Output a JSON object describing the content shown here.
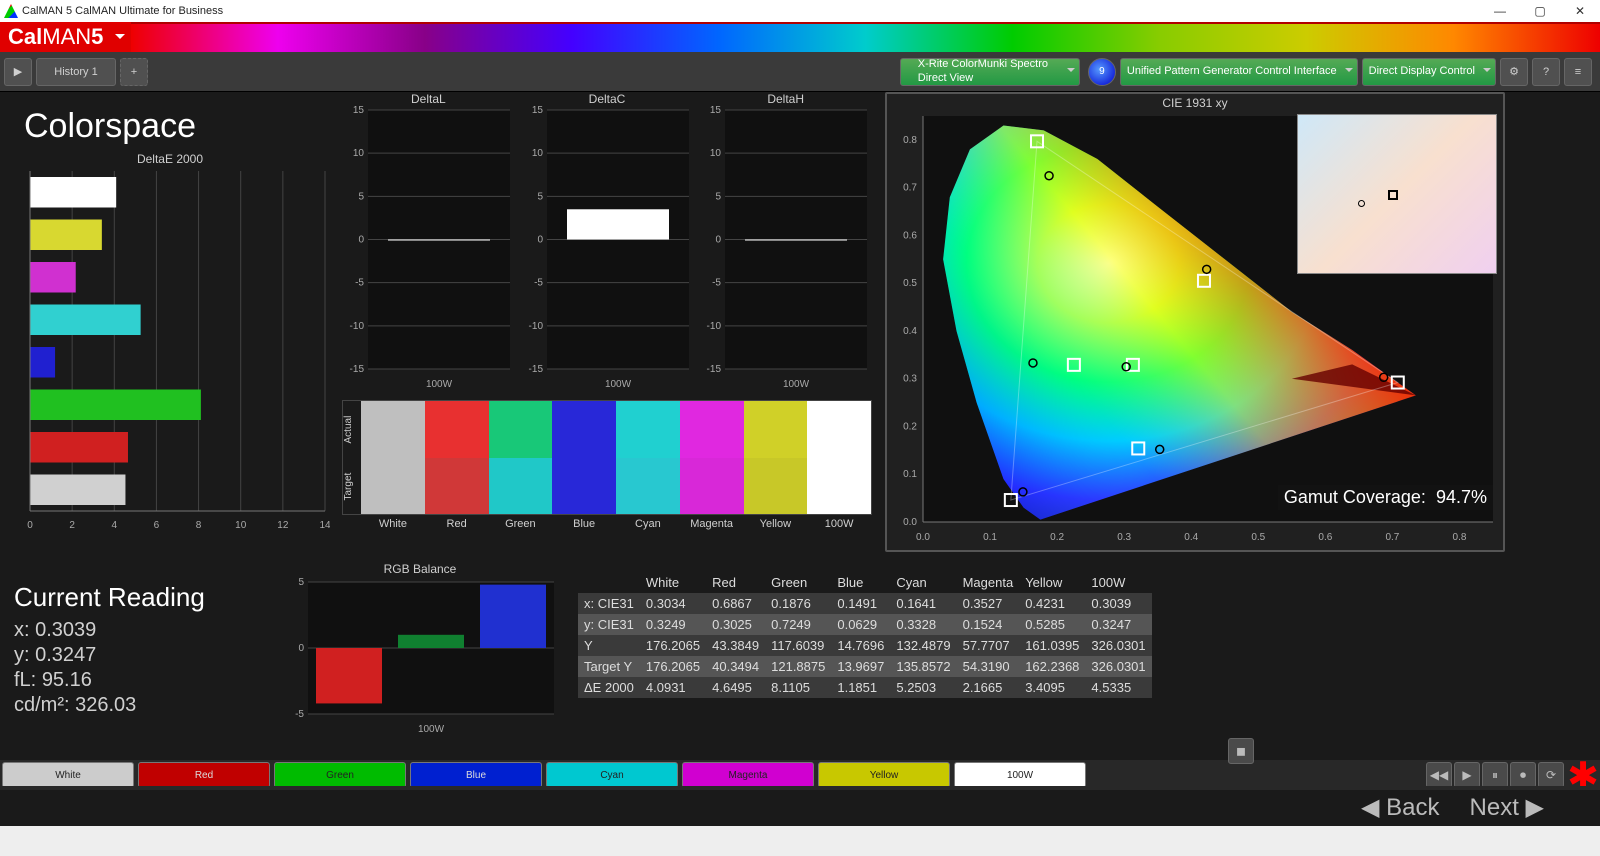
{
  "window": {
    "title": "CalMAN 5 CalMAN Ultimate for Business",
    "minimize": "—",
    "maximize": "▢",
    "close": "✕"
  },
  "brand": {
    "name_a": "Cal",
    "name_b": "MAN",
    "name_c": "5"
  },
  "toolbar": {
    "history_tab": "History 1",
    "meter": "X-Rite ColorMunki Spectro\nDirect View",
    "meter_badge": "9",
    "source": "Unified Pattern Generator Control Interface",
    "display": "Direct Display Control"
  },
  "page": {
    "title": "Colorspace",
    "current_heading": "Current Reading",
    "current": {
      "x_label": "x:",
      "x": "0.3039",
      "y_label": "y:",
      "y": "0.3247",
      "fl_label": "fL:",
      "fl": "95.16",
      "cd_label": "cd/m²:",
      "cd": "326.03"
    }
  },
  "footer": {
    "back": "Back",
    "next": "Next",
    "colors": [
      "White",
      "Red",
      "Green",
      "Blue",
      "Cyan",
      "Magenta",
      "Yellow",
      "100W"
    ],
    "fills": [
      "#cccccc",
      "#c00000",
      "#00bb00",
      "#0020d0",
      "#00c8d0",
      "#d000d0",
      "#c8c800",
      "#ffffff"
    ]
  },
  "cie": {
    "title": "CIE 1931 xy",
    "gamut_label": "Gamut Coverage:",
    "gamut_value": "94.7%"
  },
  "table": {
    "cols": [
      "",
      "White",
      "Red",
      "Green",
      "Blue",
      "Cyan",
      "Magenta",
      "Yellow",
      "100W"
    ],
    "rows": [
      [
        "x: CIE31",
        "0.3034",
        "0.6867",
        "0.1876",
        "0.1491",
        "0.1641",
        "0.3527",
        "0.4231",
        "0.3039"
      ],
      [
        "y: CIE31",
        "0.3249",
        "0.3025",
        "0.7249",
        "0.0629",
        "0.3328",
        "0.1524",
        "0.5285",
        "0.3247"
      ],
      [
        "Y",
        "176.2065",
        "43.3849",
        "117.6039",
        "14.7696",
        "132.4879",
        "57.7707",
        "161.0395",
        "326.0301"
      ],
      [
        "Target Y",
        "176.2065",
        "40.3494",
        "121.8875",
        "13.9697",
        "135.8572",
        "54.3190",
        "162.2368",
        "326.0301"
      ],
      [
        "ΔE 2000",
        "4.0931",
        "4.6495",
        "8.1105",
        "1.1851",
        "5.2503",
        "2.1665",
        "3.4095",
        "4.5335"
      ]
    ]
  },
  "chart_data": {
    "deltaE": {
      "type": "bar",
      "title": "DeltaE 2000",
      "xlim": [
        0,
        14
      ],
      "categories": [
        "White",
        "Yellow",
        "Magenta",
        "Cyan",
        "Blue",
        "Green",
        "Red",
        "100W"
      ],
      "values": [
        4.09,
        3.41,
        2.17,
        5.25,
        1.19,
        8.11,
        4.65,
        4.53
      ],
      "colors": [
        "#ffffff",
        "#d8d830",
        "#d030d0",
        "#30d0d0",
        "#2020d0",
        "#20c020",
        "#d02020",
        "#d0d0d0"
      ]
    },
    "deltaL": {
      "type": "bar",
      "title": "DeltaL",
      "ylim": [
        -15,
        15
      ],
      "point": "100W",
      "value": 0
    },
    "deltaC": {
      "type": "bar",
      "title": "DeltaC",
      "ylim": [
        -15,
        15
      ],
      "point": "100W",
      "value": 3.5
    },
    "deltaH": {
      "type": "bar",
      "title": "DeltaH",
      "ylim": [
        -15,
        15
      ],
      "point": "100W",
      "value": 0
    },
    "rgbBalance": {
      "type": "bar",
      "title": "RGB Balance",
      "ylim": [
        -5,
        5
      ],
      "point": "100W",
      "series": [
        {
          "name": "R",
          "value": -4.2,
          "color": "#d02020"
        },
        {
          "name": "G",
          "value": 1.0,
          "color": "#108030"
        },
        {
          "name": "B",
          "value": 4.8,
          "color": "#2030d0"
        }
      ]
    },
    "swatches": {
      "labels": [
        "White",
        "Red",
        "Green",
        "Blue",
        "Cyan",
        "Magenta",
        "Yellow",
        "100W"
      ],
      "actual": [
        "#bfbfbf",
        "#e83030",
        "#18c878",
        "#2828d8",
        "#20d0d0",
        "#e028e0",
        "#d0d028",
        "#ffffff"
      ],
      "target": [
        "#bfbfbf",
        "#d03838",
        "#20c8c8",
        "#2828d8",
        "#28c8d0",
        "#d828d8",
        "#c8c828",
        "#ffffff"
      ]
    },
    "cie_points": {
      "targets": [
        [
          0.313,
          0.329
        ],
        [
          0.708,
          0.292
        ],
        [
          0.17,
          0.797
        ],
        [
          0.131,
          0.046
        ],
        [
          0.225,
          0.329
        ],
        [
          0.321,
          0.154
        ],
        [
          0.419,
          0.505
        ]
      ],
      "target_names": [
        "White",
        "Red",
        "Green",
        "Blue",
        "Cyan",
        "Magenta",
        "Yellow"
      ],
      "measured": [
        [
          0.303,
          0.325
        ],
        [
          0.687,
          0.303
        ],
        [
          0.188,
          0.725
        ],
        [
          0.149,
          0.063
        ],
        [
          0.164,
          0.333
        ],
        [
          0.353,
          0.152
        ],
        [
          0.423,
          0.529
        ]
      ]
    }
  }
}
